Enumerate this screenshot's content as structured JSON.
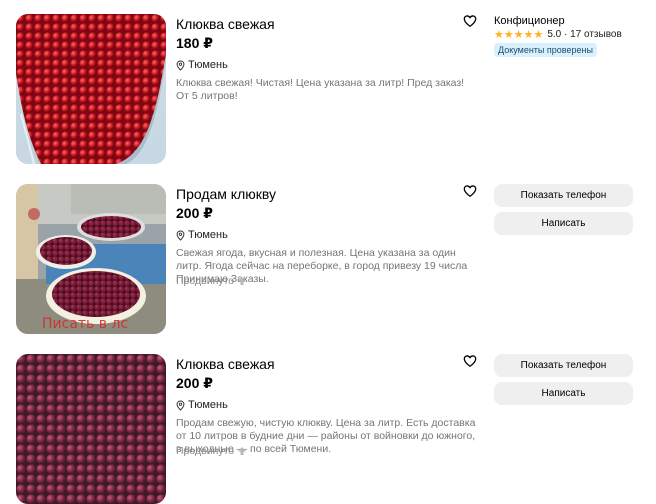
{
  "listings": [
    {
      "title": "Клюква свежая",
      "price": "180 ₽",
      "location": "Тюмень",
      "description": "Клюква свежая! Чистая! Цена указана за литр! Пред заказ! От 5 литров!",
      "seller": {
        "name": "Конфиционер",
        "stars": "★★★★★",
        "rating_text": "5.0 · 17 отзывов",
        "badge": "Документы проверены"
      }
    },
    {
      "title": "Продам клюкву",
      "price": "200 ₽",
      "location": "Тюмень",
      "description": "Свежая ягода, вкусная и полезная. Цена указана за один литр. Ягода сейчас на переборке, в город привезу 19 числа Принимаю Заказы.",
      "promoted": "Продвинуто",
      "photo_watermark": "Писать в лс",
      "buttons": {
        "phone": "Показать телефон",
        "message": "Написать"
      }
    },
    {
      "title": "Клюква свежая",
      "price": "200 ₽",
      "location": "Тюмень",
      "description": "Продам свежую, чистую клюкву. Цена за литр. Есть доставка от 10 литров в будние дни — районы от войновки до южного, в выходные — по всей Тюмени.",
      "promoted": "Продвинуто",
      "buttons": {
        "phone": "Показать телефон",
        "message": "Написать"
      }
    }
  ],
  "colors": {
    "accent_badge_bg": "#d9f0ff",
    "star": "#ffb021",
    "button_bg": "#efefef",
    "description_text": "#757575"
  },
  "icons": [
    "heart-outline-icon",
    "location-pin-icon",
    "arrow-up-icon",
    "star-icon"
  ]
}
